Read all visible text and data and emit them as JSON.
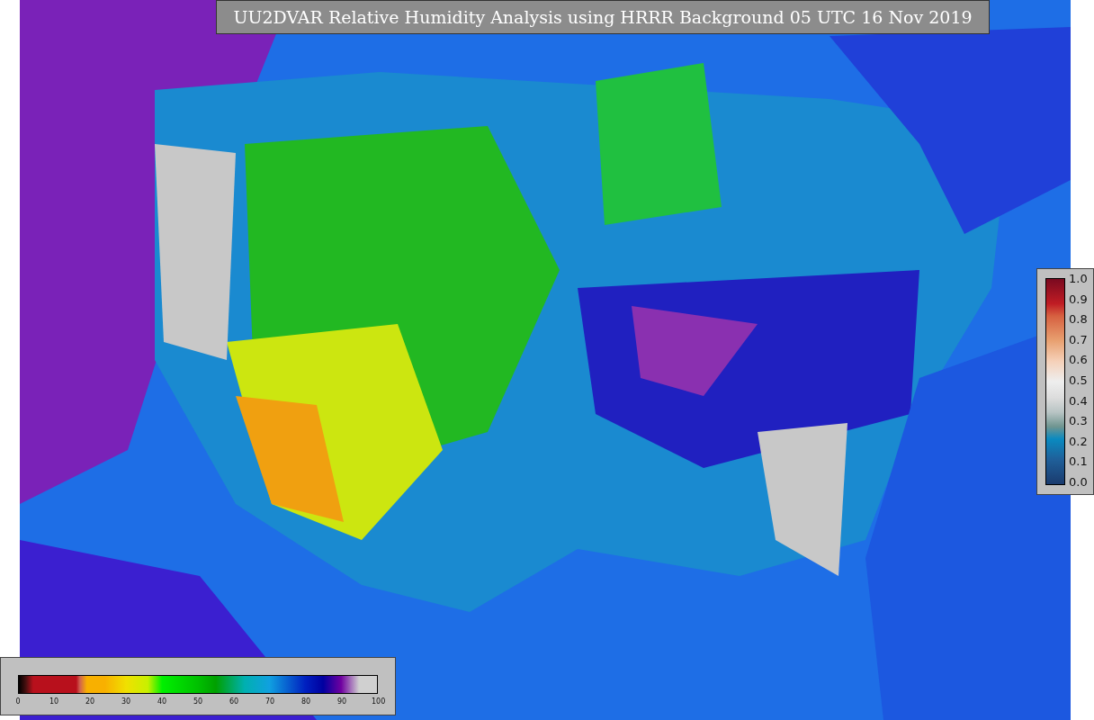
{
  "title": "UU2DVAR Relative Humidity Analysis using HRRR Background 05 UTC 16 Nov 2019",
  "humidity_colorbar": {
    "ticks": [
      "0",
      "10",
      "20",
      "30",
      "40",
      "50",
      "60",
      "70",
      "80",
      "90",
      "100"
    ]
  },
  "weight_colorbar": {
    "ticks": [
      "1.0",
      "0.9",
      "0.8",
      "0.7",
      "0.6",
      "0.5",
      "0.4",
      "0.3",
      "0.2",
      "0.1",
      "0.0"
    ]
  }
}
